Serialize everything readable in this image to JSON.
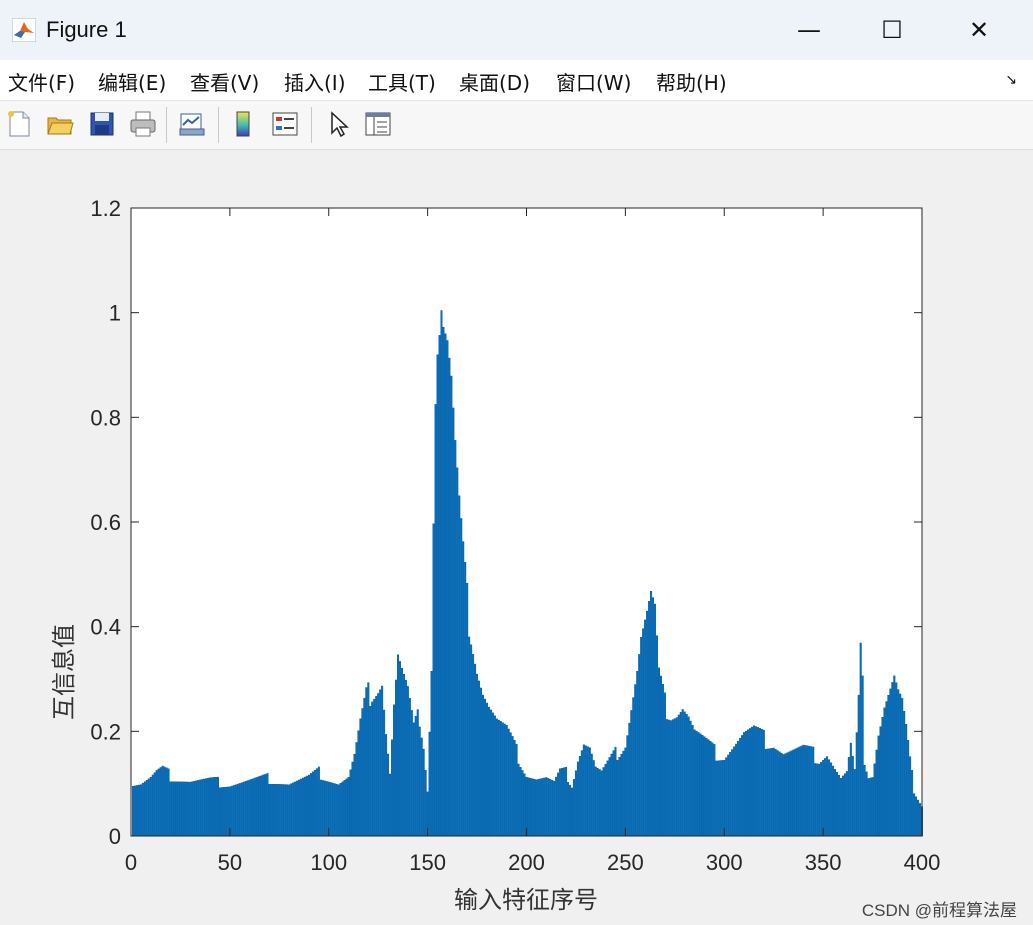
{
  "window": {
    "title": "Figure 1",
    "minimize_glyph": "—",
    "maximize_glyph": "☐",
    "close_glyph": "✕"
  },
  "menu": {
    "items": [
      "文件(F)",
      "编辑(E)",
      "查看(V)",
      "插入(I)",
      "工具(T)",
      "桌面(D)",
      "窗口(W)",
      "帮助(H)"
    ]
  },
  "toolbar": {
    "icons": [
      "new-figure-icon",
      "open-file-icon",
      "save-icon",
      "print-icon",
      "link-plot-icon",
      "colorbar-icon",
      "legend-icon",
      "pointer-icon",
      "property-editor-icon"
    ]
  },
  "chart_data": {
    "type": "bar",
    "title": "",
    "xlabel": "输入特征序号",
    "ylabel": "互信息值",
    "xlim": [
      0,
      400
    ],
    "ylim": [
      0,
      1.2
    ],
    "xticks": [
      0,
      50,
      100,
      150,
      200,
      250,
      300,
      350,
      400
    ],
    "yticks": [
      0,
      0.2,
      0.4,
      0.6,
      0.8,
      1,
      1.2
    ],
    "ytick_labels": [
      "0",
      "0.2",
      "0.4",
      "0.6",
      "0.8",
      "1",
      "1.2"
    ],
    "bar_color": "#0072bd",
    "grid": false,
    "profile_points": [
      [
        1,
        0.1
      ],
      [
        5,
        0.1
      ],
      [
        10,
        0.11
      ],
      [
        13,
        0.12
      ],
      [
        16,
        0.125
      ],
      [
        20,
        0.115
      ],
      [
        25,
        0.11
      ],
      [
        30,
        0.105
      ],
      [
        40,
        0.105
      ],
      [
        50,
        0.1
      ],
      [
        60,
        0.105
      ],
      [
        70,
        0.11
      ],
      [
        80,
        0.1
      ],
      [
        90,
        0.11
      ],
      [
        95,
        0.12
      ],
      [
        100,
        0.11
      ],
      [
        105,
        0.1
      ],
      [
        110,
        0.11
      ],
      [
        113,
        0.15
      ],
      [
        116,
        0.21
      ],
      [
        119,
        0.26
      ],
      [
        122,
        0.28
      ],
      [
        125,
        0.29
      ],
      [
        127,
        0.3
      ],
      [
        129,
        0.2
      ],
      [
        131,
        0.12
      ],
      [
        133,
        0.25
      ],
      [
        135,
        0.34
      ],
      [
        137,
        0.31
      ],
      [
        140,
        0.27
      ],
      [
        143,
        0.2
      ],
      [
        146,
        0.23
      ],
      [
        148,
        0.18
      ],
      [
        150,
        0.09
      ],
      [
        152,
        0.33
      ],
      [
        153,
        0.62
      ],
      [
        154,
        0.85
      ],
      [
        155,
        0.94
      ],
      [
        156,
        0.97
      ],
      [
        157,
        1.01
      ],
      [
        158,
        0.97
      ],
      [
        160,
        0.93
      ],
      [
        162,
        0.85
      ],
      [
        164,
        0.72
      ],
      [
        166,
        0.61
      ],
      [
        168,
        0.52
      ],
      [
        170,
        0.44
      ],
      [
        172,
        0.4
      ],
      [
        175,
        0.33
      ],
      [
        178,
        0.28
      ],
      [
        181,
        0.25
      ],
      [
        185,
        0.22
      ],
      [
        190,
        0.2
      ],
      [
        195,
        0.16
      ],
      [
        200,
        0.12
      ],
      [
        205,
        0.11
      ],
      [
        210,
        0.11
      ],
      [
        214,
        0.1
      ],
      [
        217,
        0.12
      ],
      [
        220,
        0.12
      ],
      [
        223,
        0.1
      ],
      [
        226,
        0.15
      ],
      [
        229,
        0.18
      ],
      [
        232,
        0.17
      ],
      [
        235,
        0.13
      ],
      [
        238,
        0.12
      ],
      [
        242,
        0.14
      ],
      [
        246,
        0.16
      ],
      [
        250,
        0.18
      ],
      [
        253,
        0.25
      ],
      [
        256,
        0.32
      ],
      [
        258,
        0.38
      ],
      [
        261,
        0.42
      ],
      [
        263,
        0.45
      ],
      [
        265,
        0.42
      ],
      [
        267,
        0.3
      ],
      [
        270,
        0.25
      ],
      [
        273,
        0.24
      ],
      [
        276,
        0.24
      ],
      [
        279,
        0.25
      ],
      [
        282,
        0.23
      ],
      [
        285,
        0.2
      ],
      [
        290,
        0.18
      ],
      [
        295,
        0.16
      ],
      [
        300,
        0.155
      ],
      [
        305,
        0.175
      ],
      [
        310,
        0.195
      ],
      [
        315,
        0.2
      ],
      [
        320,
        0.185
      ],
      [
        325,
        0.18
      ],
      [
        330,
        0.16
      ],
      [
        340,
        0.165
      ],
      [
        348,
        0.15
      ],
      [
        352,
        0.16
      ],
      [
        356,
        0.13
      ],
      [
        359,
        0.11
      ],
      [
        362,
        0.12
      ],
      [
        364,
        0.17
      ],
      [
        366,
        0.12
      ],
      [
        368,
        0.25
      ],
      [
        369,
        0.34
      ],
      [
        370,
        0.28
      ],
      [
        371,
        0.15
      ],
      [
        373,
        0.12
      ],
      [
        375,
        0.12
      ],
      [
        378,
        0.2
      ],
      [
        381,
        0.25
      ],
      [
        384,
        0.28
      ],
      [
        386,
        0.3
      ],
      [
        388,
        0.27
      ],
      [
        390,
        0.25
      ],
      [
        392,
        0.2
      ],
      [
        394,
        0.14
      ],
      [
        396,
        0.09
      ],
      [
        398,
        0.075
      ],
      [
        400,
        0.06
      ]
    ],
    "count": 400
  },
  "watermark_text": "CSDN @前程算法屋"
}
